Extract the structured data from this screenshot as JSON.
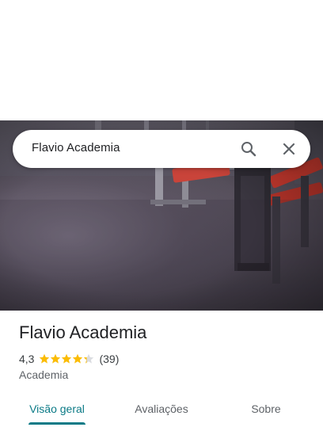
{
  "search": {
    "query": "Flavio Academia",
    "search_icon": "search-icon",
    "close_icon": "close-icon"
  },
  "place": {
    "name": "Flavio Academia",
    "rating": "4,3",
    "rating_value": 4.3,
    "rating_max": 5,
    "review_count": "(39)",
    "category": "Academia"
  },
  "tabs": [
    {
      "label": "Visão geral",
      "active": true
    },
    {
      "label": "Avaliações",
      "active": false
    },
    {
      "label": "Sobre",
      "active": false
    }
  ],
  "colors": {
    "accent": "#0b7a86",
    "star": "#fbbc04",
    "star_empty": "#dadce0",
    "text_primary": "#202124",
    "text_secondary": "#5f6368"
  }
}
